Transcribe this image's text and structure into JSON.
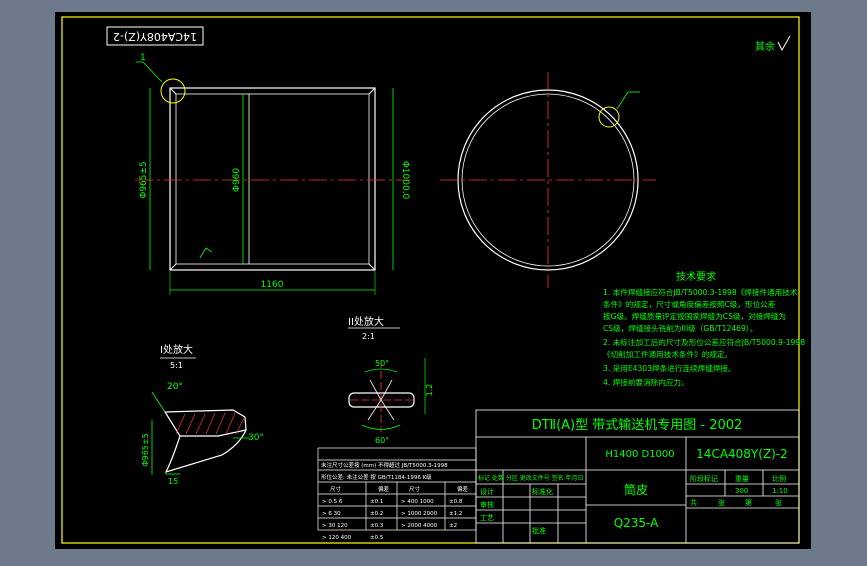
{
  "drawing": {
    "code_box": "14CA408Y(Z)-2",
    "surface_finish": "其余",
    "section_mark": "1",
    "dim_outer_dia": "Φ965±5",
    "dim_inner_dia": "Φ960",
    "dim_flange_dia": "Φ1000.0",
    "dim_length": "1160",
    "detail_I_title": "I处放大",
    "detail_I_scale": "5:1",
    "detail_II_title": "II处放大",
    "detail_II_scale": "2:1",
    "detail_angle": "20°",
    "detail_angle2": "30°",
    "detail_dia": "Φ965±5",
    "detail_len": "15",
    "groove_top_angle": "50°",
    "groove_bottom_angle": "60°",
    "groove_gap": "1.2"
  },
  "tech_notes": {
    "title": "技术要求",
    "lines": [
      "1. 本件焊缝接应符合JB/T5000.3-1998《焊接件通用技术",
      "   条件》的规定，尺寸或角度偏差按照C级，形位公差",
      "   按G级。焊缝质量评定按国家焊缝为CS级，对接焊缝为",
      "   CS级，焊缝接头铣削为III级（GB/T12469）。",
      "2. 未标注加工后的尺寸及形位公差应符合JB/T5000.9-1998",
      "   《切削加工件通用技术条件》的规定。",
      "3. 采用E4303焊条进行连续焊缝焊接。",
      "4. 焊接前要消除内应力。"
    ]
  },
  "tolerance_table": {
    "header1": "未注尺寸公差按 (mm) 不得超过 JB/T5000.3-1998",
    "header2": "形位公差: 未注公差 按 GB/T1184-1996 K级",
    "columns": [
      "尺寸",
      "偏差",
      "尺寸",
      "偏差"
    ],
    "rows": [
      [
        "> 0.5  6",
        "±0.1",
        "> 400  1000",
        "±0.8"
      ],
      [
        "> 6  30",
        "±0.2",
        "> 1000  2000",
        "±1.2"
      ],
      [
        "> 30  120",
        "±0.3",
        "> 2000  4000",
        "±2"
      ],
      [
        "> 120  400",
        "±0.5",
        "",
        ""
      ]
    ]
  },
  "title_block": {
    "main_title": "DTⅡ(A)型  带式输送机专用图 - 2002",
    "spec": "H1400  D1000",
    "drawing_no": "14CA408Y(Z)-2",
    "part_name": "筒皮",
    "material": "Q235-A",
    "stage_label": "阶段标记",
    "weight_label": "重量",
    "scale_label": "比例",
    "weight_value": "300",
    "scale_value": "1:10",
    "sheet_total": "共",
    "sheet_label": "张",
    "sheet_no": "第",
    "sheet_label2": "张",
    "revision_header": "标记 处数 分区 更改文件号 签名 年月日",
    "roles": [
      "设计",
      "审核",
      "工艺",
      "标准化",
      "批准"
    ]
  }
}
